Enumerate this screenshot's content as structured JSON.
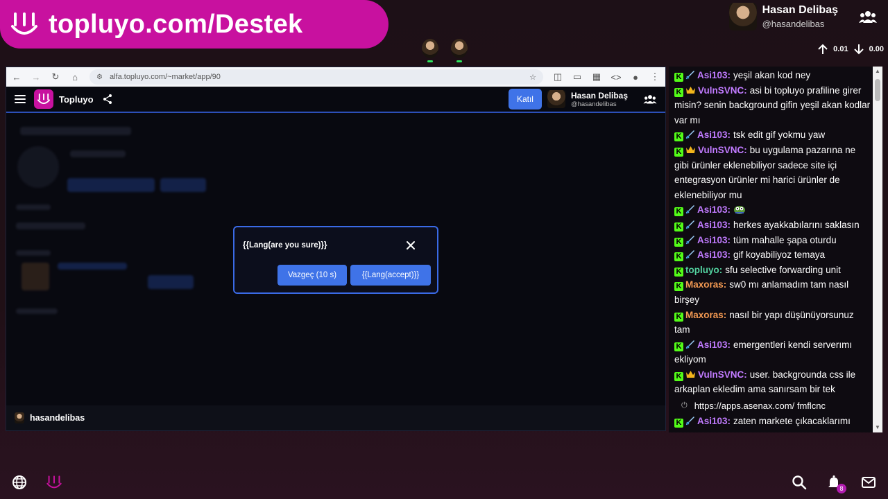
{
  "banner": {
    "text": "topluyo.com/Destek"
  },
  "top_profile": {
    "name": "Hasan Delibaş",
    "handle": "@hasandelibas"
  },
  "net_stats": {
    "upload": "0.01",
    "download": "0.00"
  },
  "browser": {
    "url": "alfa.topluyo.com/~market/app/90",
    "app_title": "Topluyo",
    "join_label": "Katıl",
    "user_name": "Hasan Delibaş",
    "user_handle": "@hasandelibas",
    "bottom_user": "hasandelibas"
  },
  "modal": {
    "title": "{{Lang(are you sure)}}",
    "cancel_label": "Vazgeç (10 s)",
    "accept_label": "{{Lang(accept)}}"
  },
  "chat": {
    "messages": [
      {
        "user": "Asi103:",
        "color": "#c17bff",
        "badge": "sword",
        "text": "yeşil akan kod ney"
      },
      {
        "user": "VulnSVNC:",
        "color": "#c17bff",
        "badge": "crown",
        "text": "asi bi topluyo prafiline girer misin? senin background gifin yeşil akan kodlar var mı"
      },
      {
        "user": "Asi103:",
        "color": "#c17bff",
        "badge": "sword",
        "text": "tsk edit gif yokmu yaw"
      },
      {
        "user": "VulnSVNC:",
        "color": "#c17bff",
        "badge": "crown",
        "text": "bu uygulama pazarına ne gibi ürünler eklenebiliyor sadece site içi entegrasyon ürünler mi harici ürünler de eklenebiliyor mu"
      },
      {
        "user": "Asi103:",
        "color": "#c17bff",
        "badge": "sword",
        "text": "",
        "emote": "pepe-emote"
      },
      {
        "user": "Asi103:",
        "color": "#c17bff",
        "badge": "sword",
        "text": "herkes ayakkabılarını saklasın"
      },
      {
        "user": "Asi103:",
        "color": "#c17bff",
        "badge": "sword",
        "text": "tüm mahalle şapa oturdu"
      },
      {
        "user": "Asi103:",
        "color": "#c17bff",
        "badge": "sword",
        "text": "gif koyabiliyoz temaya"
      },
      {
        "user": "topluyo:",
        "color": "#53d3a0",
        "badge": "none",
        "text": "sfu selective forwarding unit"
      },
      {
        "user": "Maxoras:",
        "color": "#f49a52",
        "badge": "none",
        "text": "sw0 mı anlamadım tam nasıl birşey"
      },
      {
        "user": "Maxoras:",
        "color": "#f49a52",
        "badge": "none",
        "text": "nasıl bir yapı düşünüyorsunuz tam"
      },
      {
        "user": "Asi103:",
        "color": "#c17bff",
        "badge": "sword",
        "text": "emergentleri kendi serverımı ekliyom"
      },
      {
        "user": "VulnSVNC:",
        "color": "#c17bff",
        "badge": "crown",
        "text": "user. backgrounda css ile arkaplan ekledim ama sanırsam bir tek"
      }
    ],
    "link_preview": "https://apps.asenax.com/ fmflcnc",
    "partial_user": "Asi103:",
    "partial_text": "zaten markete çıkacaklarımı"
  },
  "colors": {
    "brand": "#c8119f",
    "accent": "#3f73e8",
    "kick_green": "#53fc18"
  },
  "notifications": {
    "count": "8"
  }
}
